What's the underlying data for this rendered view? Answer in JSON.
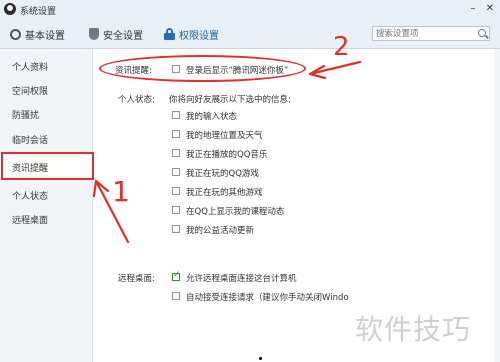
{
  "window": {
    "title": "系统设置"
  },
  "titlebar": {
    "minimize": "–",
    "close": "✕"
  },
  "tabs": [
    {
      "label": "基本设置",
      "icon": "gear-icon"
    },
    {
      "label": "安全设置",
      "icon": "shield-icon"
    },
    {
      "label": "权限设置",
      "icon": "lock-icon",
      "active": true
    }
  ],
  "search": {
    "placeholder": "搜索设置项"
  },
  "sidebar": {
    "items": [
      {
        "label": "个人资料"
      },
      {
        "label": "空间权限"
      },
      {
        "label": "防骚扰"
      },
      {
        "label": "临时会话"
      },
      {
        "label": "资讯提醒",
        "active": true
      },
      {
        "label": "个人状态"
      },
      {
        "label": "远程桌面"
      }
    ]
  },
  "news_reminder": {
    "label": "资讯提醒:",
    "option": {
      "text": "登录后显示“腾讯网迷你板”",
      "checked": false
    }
  },
  "personal_status": {
    "label": "个人状态:",
    "description": "你将向好友展示以下选中的信息:",
    "options": [
      {
        "text": "我的输入状态",
        "checked": false
      },
      {
        "text": "我的地理位置及天气",
        "checked": false
      },
      {
        "text": "我正在播放的QQ音乐",
        "checked": false
      },
      {
        "text": "我正在玩的QQ游戏",
        "checked": false
      },
      {
        "text": "我正在玩的其他游戏",
        "checked": false
      },
      {
        "text": "在QQ上显示我的课程动态",
        "checked": false
      },
      {
        "text": "我的公益活动更新",
        "checked": false
      }
    ]
  },
  "remote_desktop": {
    "label": "远程桌面:",
    "options": [
      {
        "text": "允许远程桌面连接这台计算机",
        "checked": true
      },
      {
        "text": "自动接受连接请求（建议你手动关闭Windo",
        "checked": false
      }
    ]
  },
  "annotations": {
    "num1": "1",
    "num2": "2",
    "color": "#e0302c"
  },
  "watermark": "软件技巧"
}
